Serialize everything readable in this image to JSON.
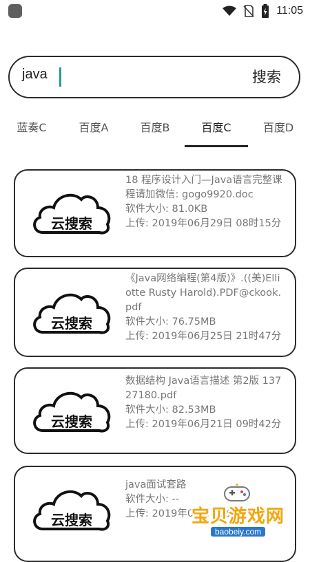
{
  "status_bar": {
    "time": "11:05"
  },
  "search": {
    "value": "java",
    "button_label": "搜索"
  },
  "tabs": [
    {
      "label": "蓝奏C"
    },
    {
      "label": "百度A"
    },
    {
      "label": "百度B"
    },
    {
      "label": "百度C",
      "active": true
    },
    {
      "label": "百度D"
    }
  ],
  "results": [
    {
      "title": "18 程序设计入门—Java语言完整课程请加微信: gogo9920.doc",
      "size": "软件大小: 81.0KB",
      "upload": "上传: 2019年06月29日 08时15分"
    },
    {
      "title": "《Java网络编程(第4版)》.((美)Elliotte Rusty Harold).PDF@ckook.pdf",
      "size": "软件大小: 76.75MB",
      "upload": "上传: 2019年06月25日 21时47分"
    },
    {
      "title": "数据结构 Java语言描述 第2版 13727180.pdf",
      "size": "软件大小: 82.53MB",
      "upload": "上传: 2019年06月21日 09时42分"
    },
    {
      "title": "java面试套路",
      "size": "软件大小: --",
      "upload": "上传: 2019年06月    00分"
    }
  ],
  "logo_text": "云搜索",
  "watermark": {
    "text": "宝贝游戏网",
    "url": "baobeiy.com"
  },
  "colors": {
    "accent_caret": "#20a090",
    "watermark": "#f2a60c"
  }
}
